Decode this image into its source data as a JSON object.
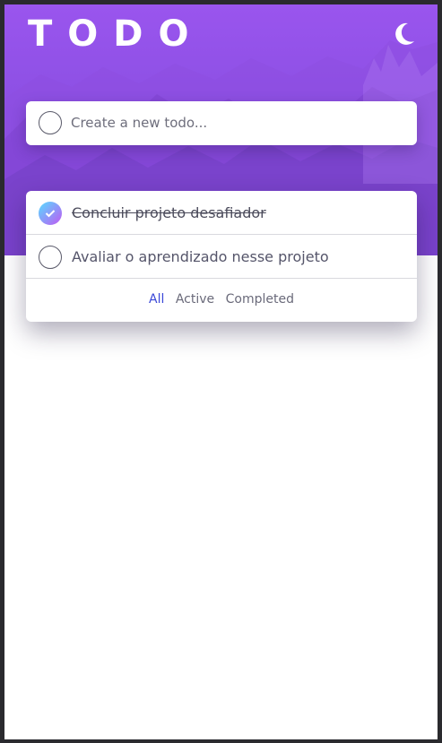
{
  "header": {
    "title": "TODO",
    "theme_icon": "moon-icon"
  },
  "new_todo": {
    "placeholder": "Create a new todo...",
    "value": ""
  },
  "todos": [
    {
      "text": "Concluir projeto desafiador",
      "completed": true
    },
    {
      "text": "Avaliar o aprendizado nesse projeto",
      "completed": false
    }
  ],
  "filters": {
    "all": "All",
    "active": "Active",
    "completed": "Completed",
    "selected": "all"
  },
  "colors": {
    "header_gradient_start": "#9a55ee",
    "header_gradient_end": "#7a45d6",
    "check_gradient_start": "#57ddff",
    "check_gradient_end": "#c058f3",
    "active_filter": "#3a48d8",
    "text": "#55556a"
  }
}
